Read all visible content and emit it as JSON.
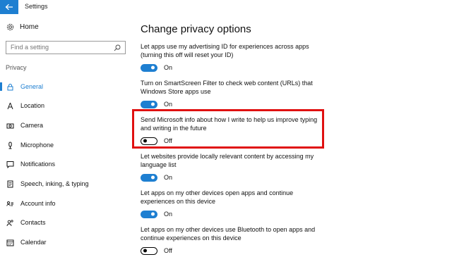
{
  "window": {
    "title": "Settings"
  },
  "sidebar": {
    "home_label": "Home",
    "search_placeholder": "Find a setting",
    "section_label": "Privacy",
    "items": [
      {
        "label": "General",
        "icon": "lock-icon",
        "active": true
      },
      {
        "label": "Location",
        "icon": "location-icon",
        "active": false
      },
      {
        "label": "Camera",
        "icon": "camera-icon",
        "active": false
      },
      {
        "label": "Microphone",
        "icon": "microphone-icon",
        "active": false
      },
      {
        "label": "Notifications",
        "icon": "notifications-icon",
        "active": false
      },
      {
        "label": "Speech, inking, & typing",
        "icon": "speech-icon",
        "active": false
      },
      {
        "label": "Account info",
        "icon": "account-info-icon",
        "active": false
      },
      {
        "label": "Contacts",
        "icon": "contacts-icon",
        "active": false
      },
      {
        "label": "Calendar",
        "icon": "calendar-icon",
        "active": false
      }
    ]
  },
  "main": {
    "title": "Change privacy options",
    "settings": [
      {
        "desc": "Let apps use my advertising ID for experiences across apps (turning this off will reset your ID)",
        "state": "On"
      },
      {
        "desc": "Turn on SmartScreen Filter to check web content (URLs) that Windows Store apps use",
        "state": "On"
      },
      {
        "desc": "Send Microsoft info about how I write to help us improve typing and writing in the future",
        "state": "Off"
      },
      {
        "desc": "Let websites provide locally relevant content by accessing my language list",
        "state": "On"
      },
      {
        "desc": "Let apps on my other devices open apps and continue experiences on this device",
        "state": "On"
      },
      {
        "desc": "Let apps on my other devices use Bluetooth to open apps and continue experiences on this device",
        "state": "Off"
      }
    ]
  },
  "colors": {
    "accent": "#1e7fd1",
    "highlight": "#e01010"
  }
}
